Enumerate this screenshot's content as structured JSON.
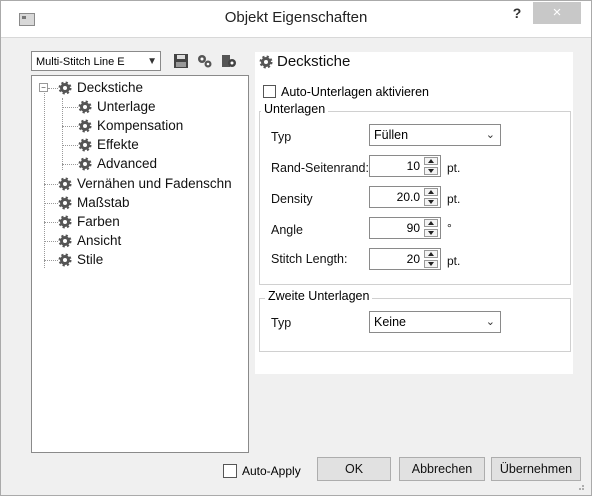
{
  "window": {
    "title": "Objekt Eigenschaften",
    "help_label": "?",
    "close_label": "×"
  },
  "toolbar": {
    "combo_value": "Multi-Stitch Line E",
    "icons": [
      "save-icon",
      "gear-pair-icon",
      "gear-settings-icon"
    ]
  },
  "tree": {
    "items": [
      {
        "label": "Deckstiche",
        "level": 0,
        "expanded": true
      },
      {
        "label": "Unterlage",
        "level": 1,
        "selected": true
      },
      {
        "label": "Kompensation",
        "level": 1
      },
      {
        "label": "Effekte",
        "level": 1
      },
      {
        "label": "Advanced",
        "level": 1
      },
      {
        "label": "Vernähen und Fadenschn",
        "level": 0
      },
      {
        "label": "Maßstab",
        "level": 0
      },
      {
        "label": "Farben",
        "level": 0
      },
      {
        "label": "Ansicht",
        "level": 0
      },
      {
        "label": "Stile",
        "level": 0
      }
    ]
  },
  "panel": {
    "title": "Deckstiche",
    "auto_underlay_label": "Auto-Unterlagen aktivieren",
    "auto_underlay_checked": false,
    "underlay_group": {
      "legend": "Unterlagen",
      "type_label": "Typ",
      "type_value": "Füllen",
      "fields": [
        {
          "label": "Rand-Seitenrand:",
          "value": "10",
          "unit": "pt."
        },
        {
          "label": "Density",
          "value": "20.0",
          "unit": "pt."
        },
        {
          "label": "Angle",
          "value": "90",
          "unit": "°"
        },
        {
          "label": "Stitch Length:",
          "value": "20",
          "unit": "pt."
        }
      ]
    },
    "second_group": {
      "legend": "Zweite Unterlagen",
      "type_label": "Typ",
      "type_value": "Keine"
    }
  },
  "footer": {
    "auto_apply_label": "Auto-Apply",
    "auto_apply_checked": false,
    "ok_label": "OK",
    "cancel_label": "Abbrechen",
    "apply_label": "Übernehmen"
  }
}
